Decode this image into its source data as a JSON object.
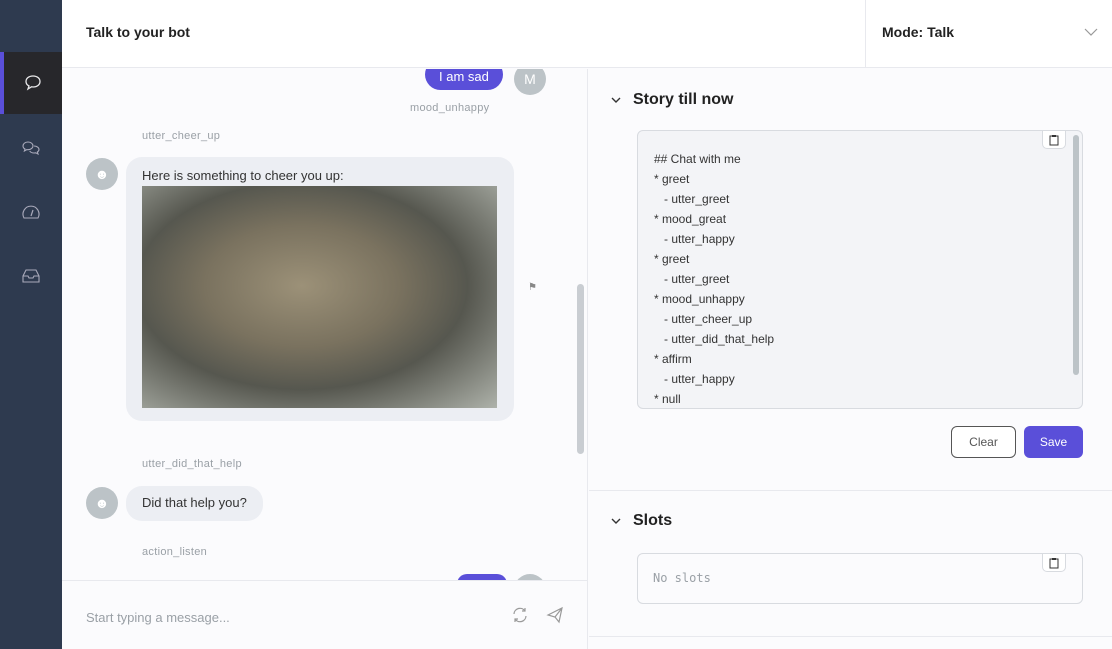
{
  "header": {
    "title": "Talk to your bot",
    "mode": "Mode: Talk"
  },
  "chat": {
    "messages": [
      {
        "type": "user",
        "text": "I am sad",
        "avatar": "M",
        "intent": "mood_unhappy"
      },
      {
        "type": "bot",
        "action": "utter_cheer_up",
        "text": "Here is something to cheer you up:",
        "image": "tiger cub"
      },
      {
        "type": "bot",
        "action": "utter_did_that_help",
        "text": "Did that help you?"
      },
      {
        "type": "action",
        "action": "action_listen"
      }
    ],
    "placeholder": "Start typing a message..."
  },
  "story": {
    "title": "Story till now",
    "content": "## Chat with me\n* greet\n   - utter_greet\n* mood_great\n   - utter_happy\n* greet\n   - utter_greet\n* mood_unhappy\n   - utter_cheer_up\n   - utter_did_that_help\n* affirm\n   - utter_happy\n* null",
    "clear": "Clear",
    "save": "Save"
  },
  "slots": {
    "title": "Slots",
    "content": "No slots"
  },
  "colors": {
    "accent": "#5a4fd9",
    "sidebar": "#2e3a4f"
  }
}
